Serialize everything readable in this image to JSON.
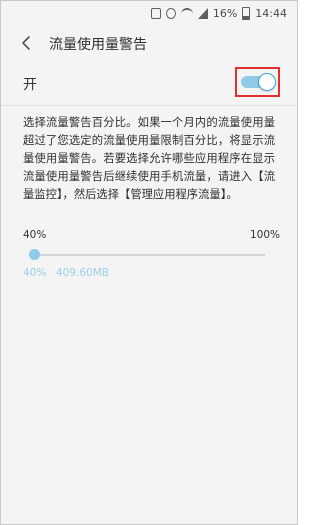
{
  "status_bar": {
    "battery_percent": "16%",
    "time": "14:44",
    "icons": [
      "nfc-icon",
      "mute-icon",
      "wifi-icon",
      "signal-icon",
      "battery-icon"
    ]
  },
  "header": {
    "title": "流量使用量警告",
    "back_icon": "back-arrow-icon"
  },
  "toggle": {
    "label": "开",
    "state": "on",
    "accent_color": "#3fa6d8",
    "highlight_color": "#e03030"
  },
  "description": "选择流量警告百分比。如果一个月内的流量使用量超过了您选定的流量使用量限制百分比，将显示流量使用量警告。若要选择允许哪些应用程序在显示流量使用量警告后继续使用手机流量，请进入【流量监控】，然后选择【管理应用程序流量】。",
  "slider": {
    "min_label": "40%",
    "max_label": "100%",
    "current_percent": "40%",
    "current_amount": "409.60MB",
    "value": 40
  }
}
